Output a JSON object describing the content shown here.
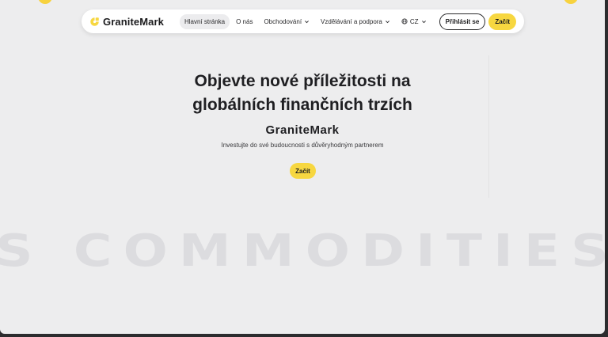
{
  "brand": {
    "name": "GraniteMark",
    "accent_color": "#f7d740"
  },
  "nav": {
    "items": [
      {
        "label": "Hlavní stránka",
        "active": true,
        "has_dropdown": false
      },
      {
        "label": "O nás",
        "active": false,
        "has_dropdown": false
      },
      {
        "label": "Obchodování",
        "active": false,
        "has_dropdown": true
      },
      {
        "label": "Vzdělávání a podpora",
        "active": false,
        "has_dropdown": true
      }
    ],
    "language": {
      "label": "CZ",
      "icon": "globe-icon"
    },
    "login_label": "Přihlásit se",
    "start_label": "Začít"
  },
  "hero": {
    "title_line1": "Objevte nové příležitosti na",
    "title_line2": "globálních finančních trzích",
    "brand": "GraniteMark",
    "subtitle": "Investujte do své budoucnosti s důvěryhodným partnerem",
    "cta_label": "Začít"
  },
  "marquee": {
    "text": "S COMMODITIES A"
  }
}
